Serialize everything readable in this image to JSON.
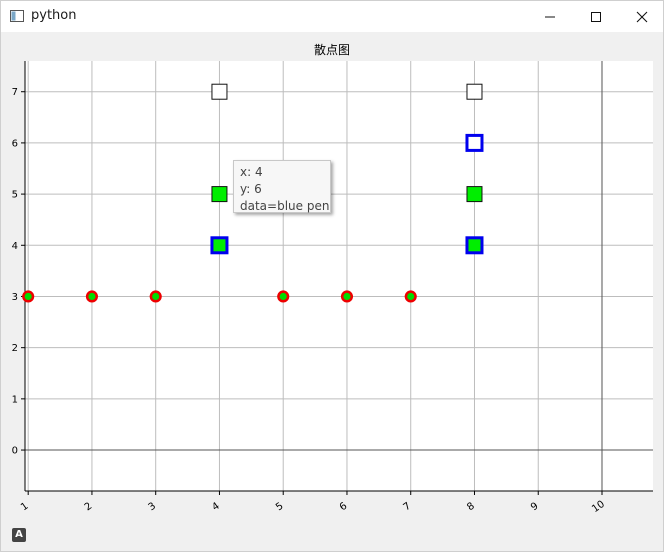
{
  "window": {
    "title": "python"
  },
  "tooltip": {
    "x_line": "x: 4",
    "y_line": "y: 6",
    "data_line": "data=blue pen"
  },
  "corner_badge": "A",
  "chart_data": {
    "type": "scatter",
    "title": "散点图",
    "xlabel": "",
    "ylabel": "",
    "xlim": [
      0.95,
      10.8
    ],
    "ylim": [
      -0.8,
      7.6
    ],
    "xticks": [
      1,
      2,
      3,
      4,
      5,
      6,
      7,
      8,
      9,
      10
    ],
    "yticks": [
      0,
      1,
      2,
      3,
      4,
      5,
      6,
      7
    ],
    "grid": true,
    "series": [
      {
        "marker": "circle",
        "fill": "#00dd00",
        "edge": "#ee0000",
        "edge_width": 2.5,
        "points": [
          [
            1,
            3
          ],
          [
            2,
            3
          ],
          [
            3,
            3
          ],
          [
            5,
            3
          ],
          [
            6,
            3
          ],
          [
            7,
            3
          ]
        ]
      },
      {
        "marker": "square",
        "fill": "#00ee00",
        "edge": "#0000ee",
        "edge_width": 3,
        "points": [
          [
            4,
            4
          ],
          [
            8,
            4
          ]
        ]
      },
      {
        "marker": "square",
        "fill": "#00ee00",
        "edge": "#111111",
        "edge_width": 1,
        "points": [
          [
            4,
            5
          ],
          [
            8,
            5
          ]
        ]
      },
      {
        "marker": "square",
        "fill": "#ffffff",
        "edge": "#0000ee",
        "edge_width": 3,
        "points": [
          [
            8,
            6
          ]
        ]
      },
      {
        "marker": "square",
        "fill": "#ffffff",
        "edge": "#111111",
        "edge_width": 1,
        "points": [
          [
            4,
            7
          ],
          [
            8,
            7
          ]
        ]
      }
    ]
  }
}
